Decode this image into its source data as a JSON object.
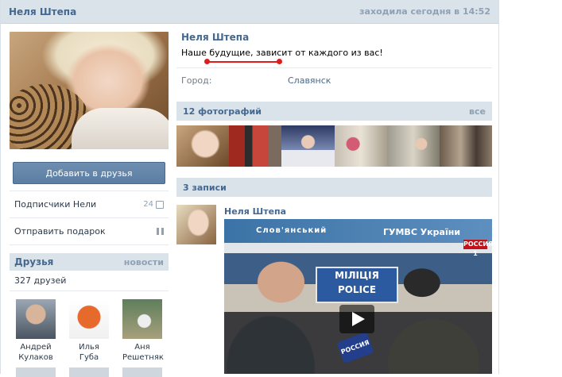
{
  "header": {
    "name": "Неля Штепа",
    "last_seen": "заходила сегодня в 14:52"
  },
  "left": {
    "add_friend": "Добавить в друзья",
    "menu": [
      {
        "label": "Подписчики Нели",
        "count": "24"
      },
      {
        "label": "Отправить подарок"
      }
    ],
    "friends": {
      "title": "Друзья",
      "news": "новости",
      "count": "327 друзей",
      "items": [
        {
          "first": "Андрей",
          "last": "Кулаков"
        },
        {
          "first": "Илья",
          "last": "Губа"
        },
        {
          "first": "Аня",
          "last": "Решетняк"
        }
      ]
    }
  },
  "profile": {
    "name": "Неля Штепа",
    "status": "Наше будущие, зависит от каждого из вас!",
    "city_label": "Город:",
    "city_value": "Славянск"
  },
  "photos": {
    "title": "12 фотографий",
    "all": "все"
  },
  "posts": {
    "title": "3 записи",
    "author": "Неля Штепа",
    "video": {
      "sign1": "Слов'янський",
      "sign2": "ГУМВС України",
      "sign3": "МІЛІЦІЯ POLICE",
      "channel": "РОССИЯ 1",
      "mic": "РОССИЯ"
    }
  },
  "colors": {
    "accent": "#45688e",
    "header_bg": "#dae2ea",
    "button": "#5b7ea3",
    "highlight": "#e21b1b"
  }
}
